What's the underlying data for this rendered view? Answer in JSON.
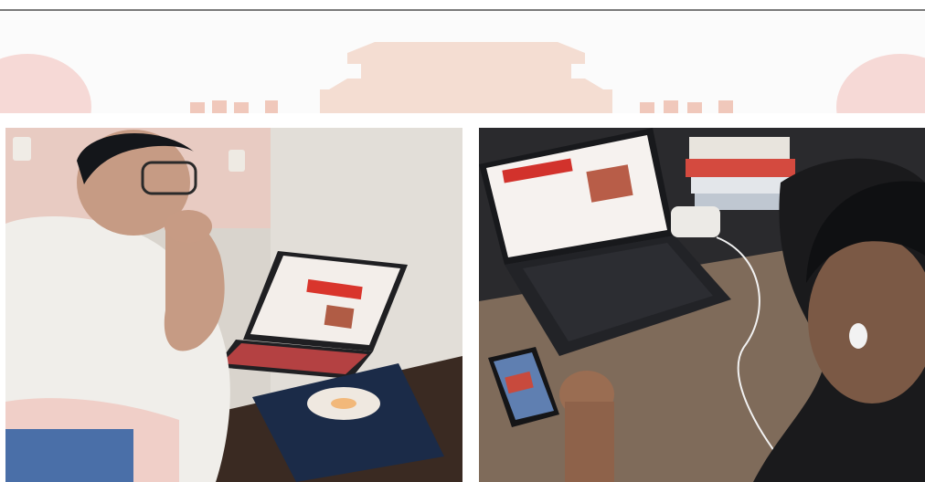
{
  "page": {
    "banner": {
      "motif": "tiananmen-gate-silhouette",
      "colors": {
        "bg": "#fbfbfb",
        "motif": "#f3d9cf",
        "accent": "#f0b7b0"
      }
    },
    "photos": [
      {
        "id": "left",
        "scene": "person-with-glasses-watching-laptop-presentation",
        "screen_colors": {
          "slide_bg": "#f5f1ee",
          "banner": "#d9352c",
          "keyboard_backlight": "#e24b4b"
        }
      },
      {
        "id": "right",
        "scene": "person-watching-laptop-and-phone-with-earphones",
        "screen_colors": {
          "slide_bg": "#f6f2ef",
          "banner": "#d2322c"
        }
      }
    ]
  }
}
